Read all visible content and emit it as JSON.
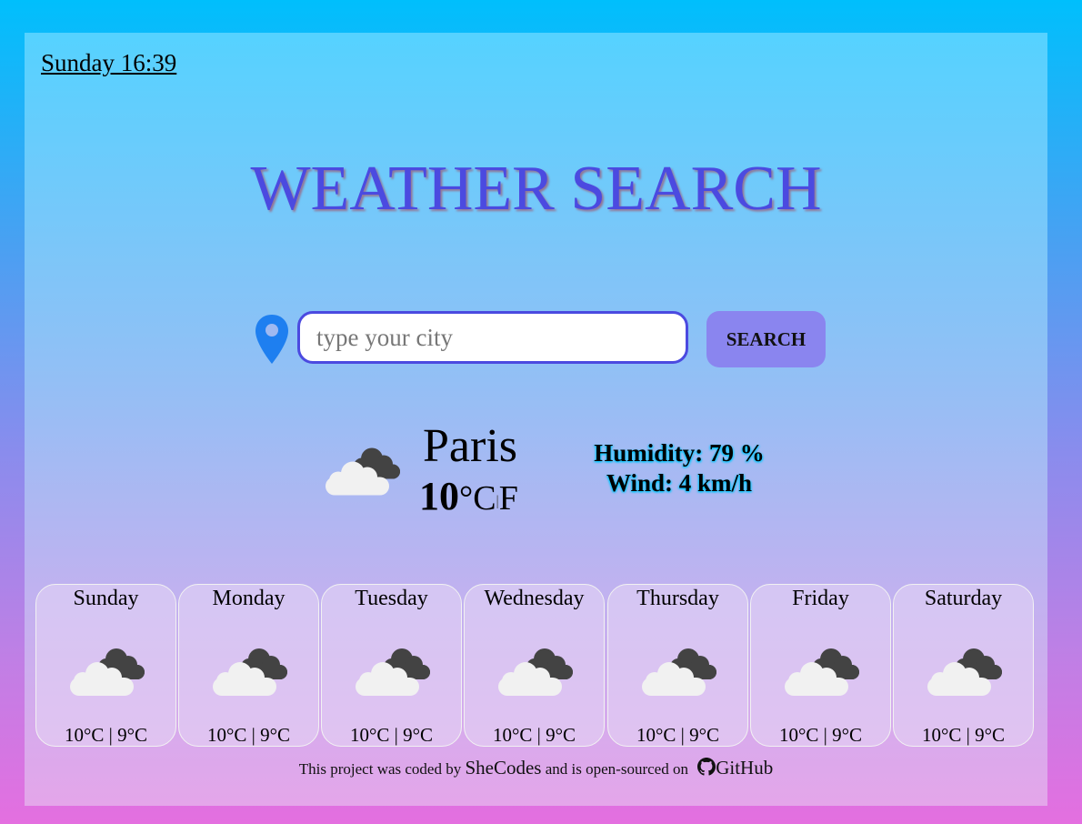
{
  "header": {
    "datetime": "Sunday 16:39"
  },
  "title": "WEATHER SEARCH",
  "search": {
    "placeholder": "type your city",
    "button_label": "SEARCH"
  },
  "current": {
    "city": "Paris",
    "temperature": "10",
    "unit_c": "°C",
    "unit_sep": "|",
    "unit_f": "F",
    "humidity": "Humidity: 79 %",
    "wind": "Wind: 4 km/h",
    "icon": "cloudy-icon"
  },
  "forecast": [
    {
      "day": "Sunday",
      "temps": "10°C | 9°C",
      "icon": "cloudy-icon"
    },
    {
      "day": "Monday",
      "temps": "10°C | 9°C",
      "icon": "cloudy-icon"
    },
    {
      "day": "Tuesday",
      "temps": "10°C | 9°C",
      "icon": "cloudy-icon"
    },
    {
      "day": "Wednesday",
      "temps": "10°C | 9°C",
      "icon": "cloudy-icon"
    },
    {
      "day": "Thursday",
      "temps": "10°C | 9°C",
      "icon": "cloudy-icon"
    },
    {
      "day": "Friday",
      "temps": "10°C | 9°C",
      "icon": "cloudy-icon"
    },
    {
      "day": "Saturday",
      "temps": "10°C | 9°C",
      "icon": "cloudy-icon"
    }
  ],
  "footer": {
    "text_1": "This project was coded by",
    "link_1": "SheCodes",
    "text_2": "and is open-sourced on",
    "link_2": "GitHub"
  },
  "colors": {
    "accent": "#4b4ae0",
    "button": "#8a85ef",
    "pin": "#1e7ff0"
  }
}
